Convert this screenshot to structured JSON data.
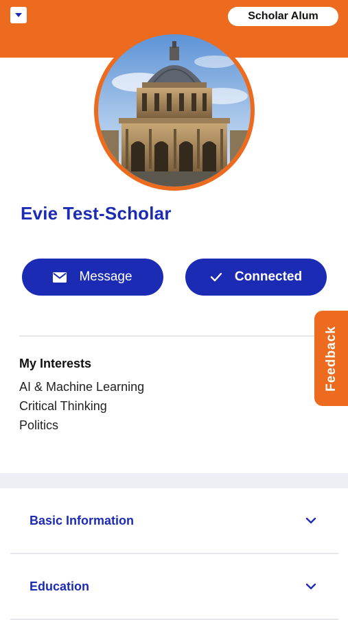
{
  "header": {
    "badge_label": "Scholar Alum",
    "accent_color": "#ec6b1f",
    "menu_icon": "caret-down-icon"
  },
  "profile": {
    "name": "Evie Test-Scholar",
    "avatar_icon": "profile-photo-building"
  },
  "actions": {
    "message_label": "Message",
    "message_icon": "envelope-icon",
    "connected_label": "Connected",
    "connected_icon": "check-icon",
    "button_color": "#1c2bb3"
  },
  "interests": {
    "title": "My Interests",
    "items": [
      "AI & Machine Learning",
      "Critical Thinking",
      "Politics"
    ]
  },
  "feedback": {
    "label": "Feedback"
  },
  "sections": [
    {
      "label": "Basic Information",
      "icon": "chevron-down-icon"
    },
    {
      "label": "Education",
      "icon": "chevron-down-icon"
    }
  ]
}
